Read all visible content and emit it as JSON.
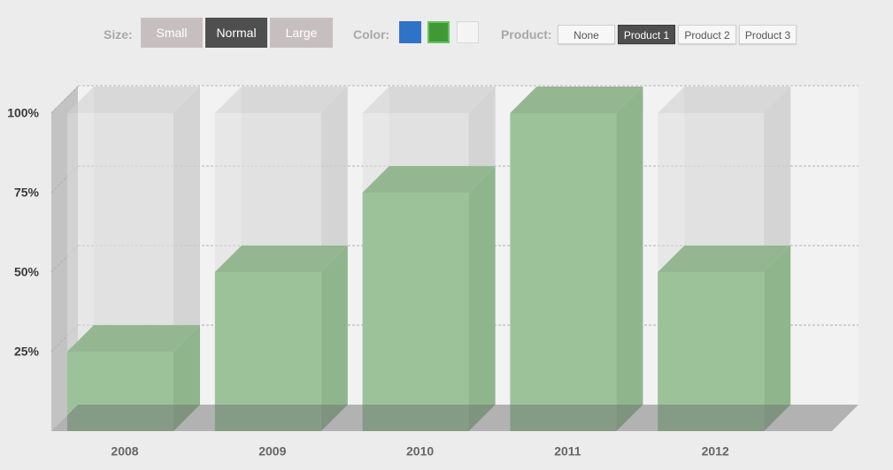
{
  "controls": {
    "size_label": "Size:",
    "size_options": [
      "Small",
      "Normal",
      "Large"
    ],
    "size_selected": "Normal",
    "color_label": "Color:",
    "color_options": [
      {
        "name": "blue",
        "hex": "#2f73c9"
      },
      {
        "name": "green",
        "hex": "#3f9a35"
      },
      {
        "name": "white",
        "hex": "#f4f4f4"
      }
    ],
    "product_label": "Product:",
    "product_options": [
      "None",
      "Product 1",
      "Product 2",
      "Product 3"
    ],
    "product_selected": "Product 1"
  },
  "chart_data": {
    "type": "bar",
    "style": "3d",
    "categories": [
      "2008",
      "2009",
      "2010",
      "2011",
      "2012"
    ],
    "values": [
      25,
      50,
      75,
      100,
      50
    ],
    "ylim": [
      0,
      100
    ],
    "yticks": [
      25,
      50,
      75,
      100
    ],
    "ytick_labels": [
      "25%",
      "50%",
      "75%",
      "100%"
    ],
    "grid": true,
    "bar_color": "#9cc29a",
    "ghost_color": "#dcdcdc"
  }
}
